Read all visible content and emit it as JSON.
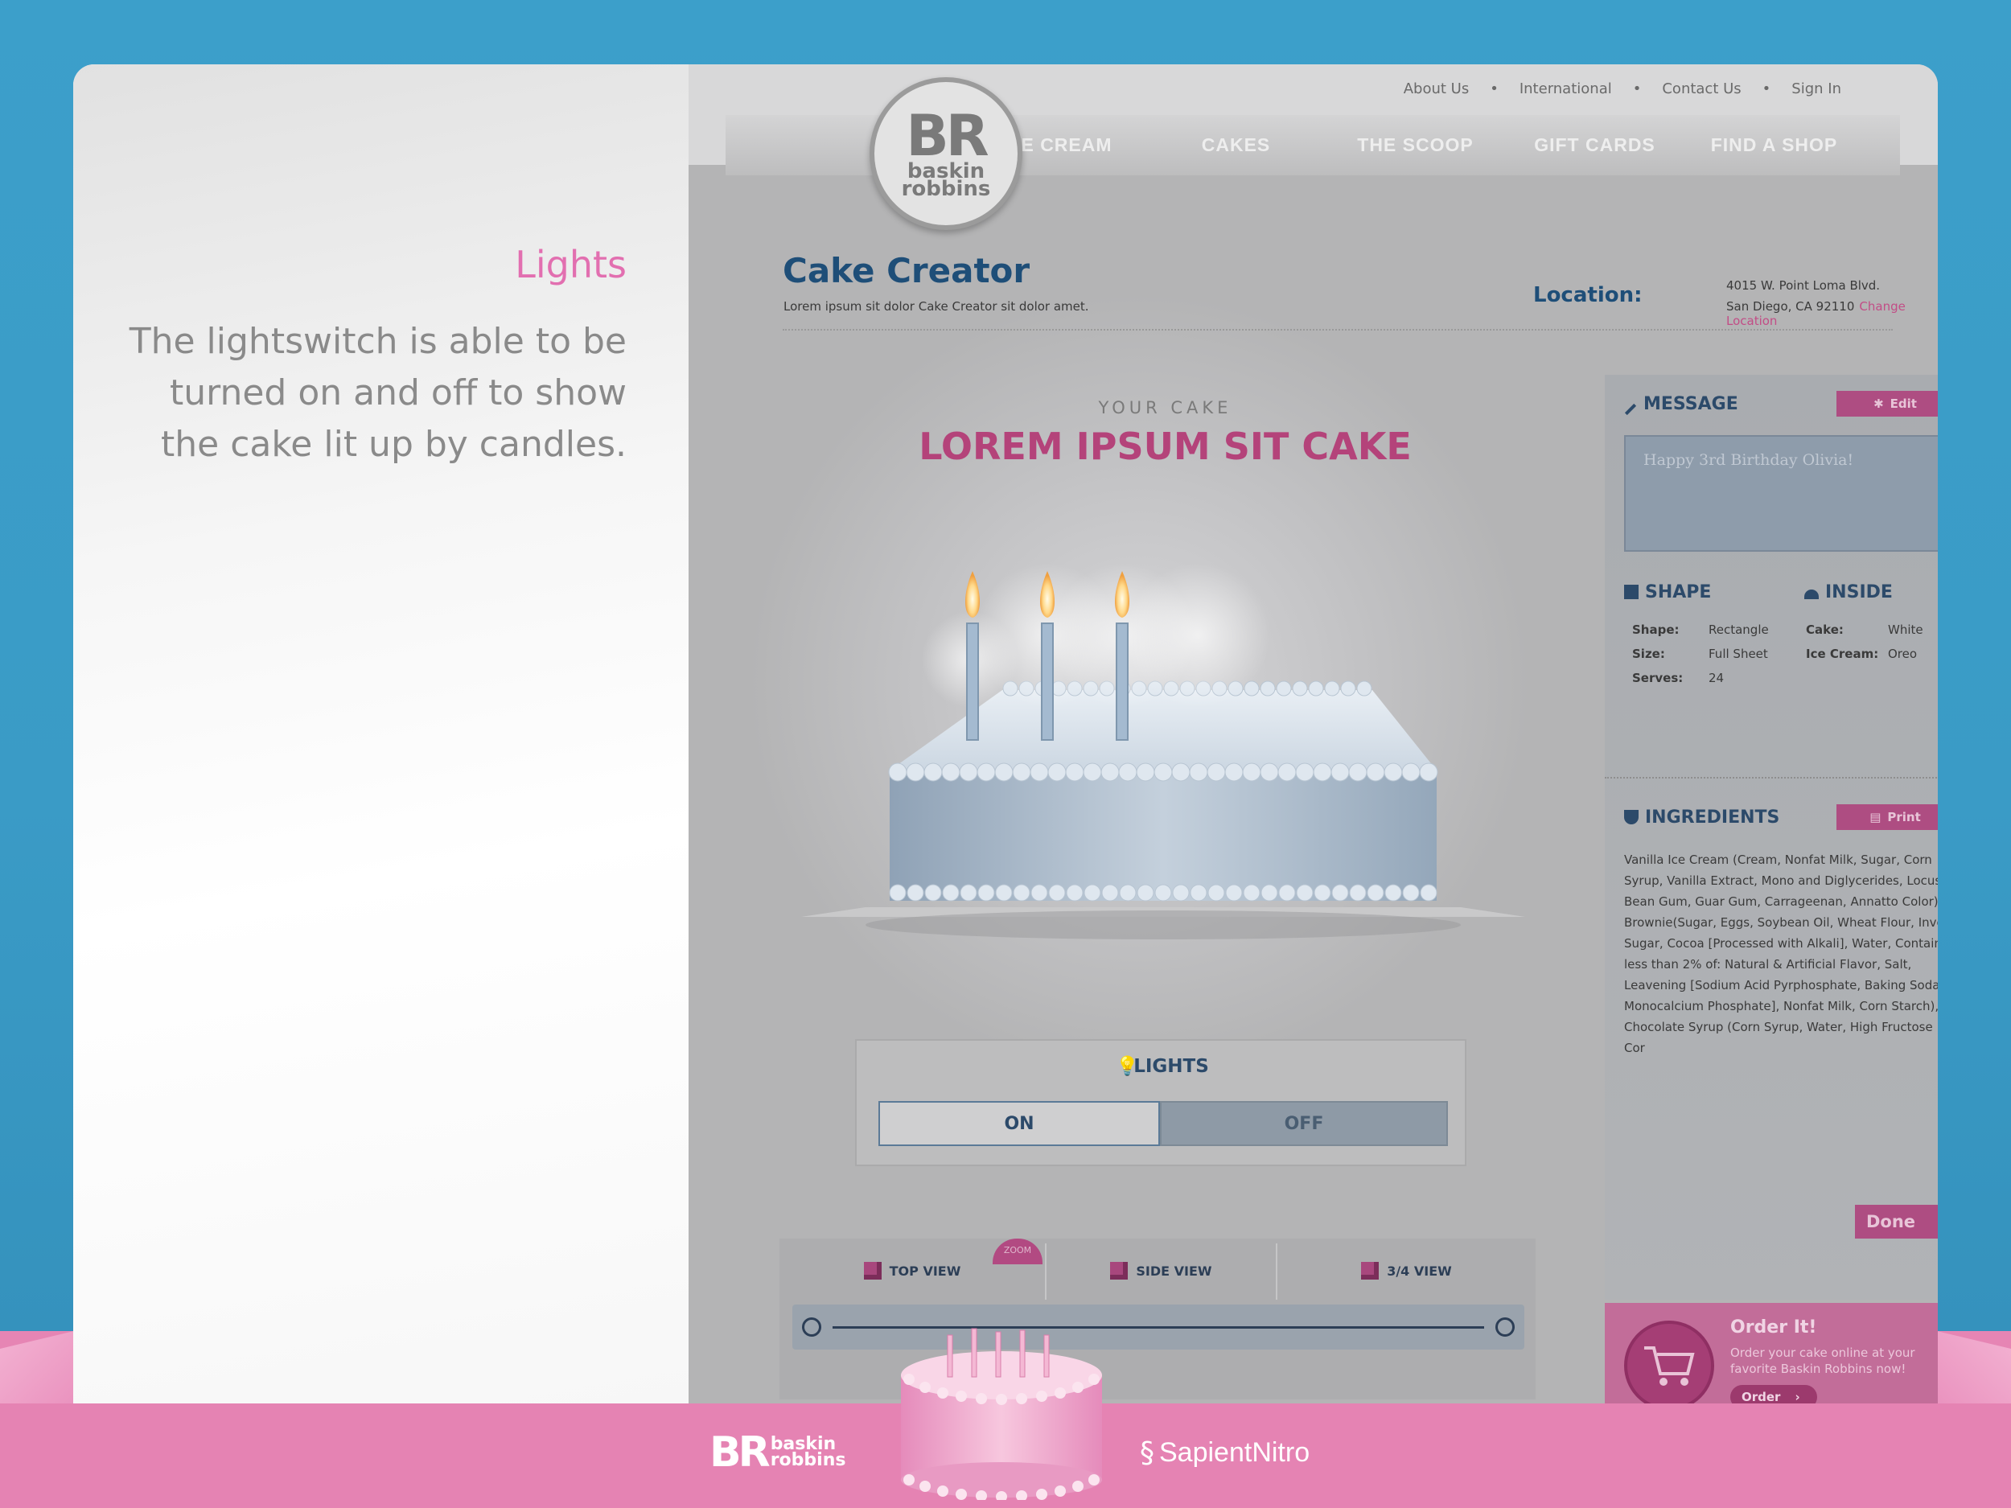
{
  "slide": {
    "title": "Lights",
    "description": "The lightswitch is able to be turned on and off to show the cake lit up by candles."
  },
  "site": {
    "util_links": [
      "About Us",
      "International",
      "Contact Us",
      "Sign In"
    ],
    "nav": [
      "ICE CREAM",
      "CAKES",
      "THE SCOOP",
      "GIFT CARDS",
      "FIND A SHOP"
    ],
    "logo": {
      "mark": "BR",
      "line1": "baskin",
      "line2": "robbins"
    },
    "page_title": "Cake Creator",
    "page_subtitle": "Lorem ipsum sit dolor Cake Creator sit dolor amet.",
    "location": {
      "label": "Location:",
      "line1": "4015 W. Point Loma Blvd.",
      "line2": "San Diego, CA 92110",
      "change": "Change Location"
    },
    "cake": {
      "label": "YOUR CAKE",
      "title": "LOREM IPSUM SIT CAKE",
      "candles": 3
    },
    "lights": {
      "title": "LIGHTS",
      "on": "ON",
      "off": "OFF",
      "selected": "ON"
    },
    "views": [
      "TOP VIEW",
      "SIDE VIEW",
      "3/4 VIEW"
    ],
    "zoom_label": "ZOOM",
    "message": {
      "heading": "MESSAGE",
      "edit": "Edit",
      "text": "Happy 3rd Birthday Olivia!"
    },
    "shape": {
      "heading": "SHAPE",
      "rows": [
        {
          "k": "Shape:",
          "v": "Rectangle"
        },
        {
          "k": "Size:",
          "v": "Full Sheet"
        },
        {
          "k": "Serves:",
          "v": "24"
        }
      ]
    },
    "inside": {
      "heading": "INSIDE",
      "rows": [
        {
          "k": "Cake:",
          "v": "White"
        },
        {
          "k": "Ice Cream:",
          "v": "Oreo"
        }
      ]
    },
    "ingredients": {
      "heading": "INGREDIENTS",
      "print": "Print",
      "text": "Vanilla Ice Cream (Cream, Nonfat Milk, Sugar, Corn Syrup, Vanilla Extract, Mono and Diglycerides, Locust Bean Gum, Guar Gum, Carrageenan, Annatto Color), Brownie(Sugar, Eggs, Soybean Oil, Wheat Flour, Invert Sugar, Cocoa [Processed with Alkali], Water, Contains less than 2% of: Natural & Artificial Flavor, Salt, Leavening [Sodium Acid Pyrphosphate, Baking Soda, Monocalcium Phosphate], Nonfat Milk, Corn Starch), Chocolate Syrup (Corn Syrup, Water, High Fructose Cor"
    },
    "done": "Done",
    "order": {
      "title": "Order It!",
      "text": "Order your cake online at your favorite Baskin Robbins now!",
      "button": "Order"
    }
  },
  "footer": {
    "brand_mark": "BR",
    "brand_line1": "baskin",
    "brand_line2": "robbins",
    "agency": "SapientNitro"
  },
  "colors": {
    "frame_blue": "#3a9cc8",
    "floor_pink": "#e685b4",
    "accent_pink": "#e26fb0",
    "brand_navy": "#1e4e78",
    "button_magenta": "#ae4d82"
  }
}
